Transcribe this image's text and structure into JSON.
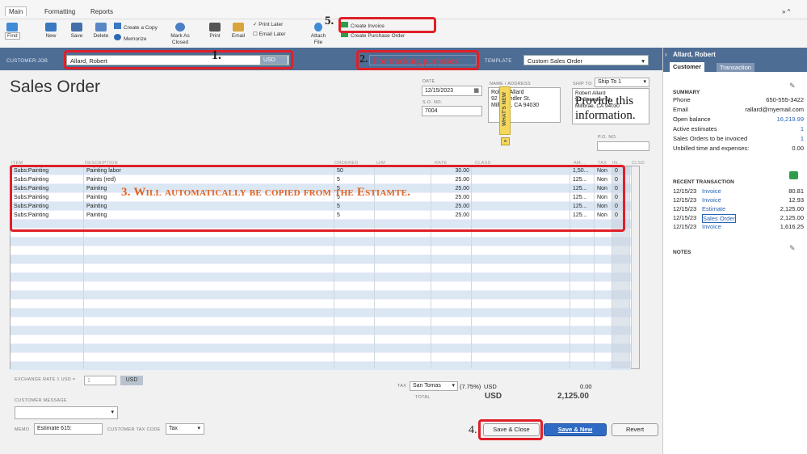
{
  "ribbon": {
    "tabs": [
      "Main",
      "Formatting",
      "Reports"
    ],
    "window_controls": "»  ^"
  },
  "toolbar": {
    "find": "Find",
    "new": "New",
    "save": "Save",
    "delete": "Delete",
    "create_copy": "Create a Copy",
    "memorize": "Memorize",
    "mark_closed": "Mark As Closed",
    "print": "Print",
    "email": "Email",
    "print_later": "Print Later",
    "email_later": "Email Later",
    "attach_file": "Attach File",
    "create_invoice": "Create Invoice",
    "create_po": "Create Purchase Order"
  },
  "customer_bar": {
    "label": "CUSTOMER:JOB",
    "customer": "Allard, Robert",
    "currency": "USD",
    "template_label": "TEMPLATE",
    "template": "Custom Sales Order",
    "class_value": "For tracking purposes"
  },
  "form": {
    "title": "Sales Order",
    "date_label": "DATE",
    "date": "12/15/2023",
    "so_label": "S.O. NO.",
    "so_no": "7004",
    "name_address_label": "NAME / ADDRESS",
    "name_address": [
      "Robert Allard",
      "92 Chandler St.",
      "Millbrae, CA 94030"
    ],
    "whats_new": "WHAT'S NEW",
    "ship_to_label": "SHIP TO",
    "ship_to": "Ship To 1",
    "ship_address": [
      "Robert Allard",
      "92 Chandler St.",
      "Millbrae, CA 94030"
    ],
    "po_label": "P.O. NO."
  },
  "grid": {
    "headers": [
      "ITEM",
      "DESCRIPTION",
      "ORDERED",
      "U/M",
      "RATE",
      "CLASS",
      "AM...",
      "TAX",
      "IN...",
      "CLSD"
    ],
    "rows": [
      {
        "item": "Subs:Painting",
        "desc": "Painting labor",
        "ordered": "50",
        "rate": "30.00",
        "amt": "1,50...",
        "tax": "Non",
        "inv": "0"
      },
      {
        "item": "Subs:Painting",
        "desc": "Paints (red)",
        "ordered": "5",
        "rate": "25.00",
        "amt": "125...",
        "tax": "Non",
        "inv": "0"
      },
      {
        "item": "Subs:Painting",
        "desc": "Painting",
        "ordered": "5",
        "rate": "25.00",
        "amt": "125...",
        "tax": "Non",
        "inv": "0"
      },
      {
        "item": "Subs:Painting",
        "desc": "Painting",
        "ordered": "5",
        "rate": "25.00",
        "amt": "125...",
        "tax": "Non",
        "inv": "0"
      },
      {
        "item": "Subs:Painting",
        "desc": "Painting",
        "ordered": "5",
        "rate": "25.00",
        "amt": "125...",
        "tax": "Non",
        "inv": "0"
      },
      {
        "item": "Subs:Painting",
        "desc": "Painting",
        "ordered": "5",
        "rate": "25.00",
        "amt": "125...",
        "tax": "Non",
        "inv": "0"
      }
    ]
  },
  "footer": {
    "exchange_label": "EXCHANGE RATE 1 USD =",
    "exchange_value": "1",
    "exchange_currency": "USD",
    "customer_message_label": "CUSTOMER MESSAGE",
    "memo_label": "MEMO",
    "memo": "Estimate 615:",
    "tax_code_label": "CUSTOMER TAX CODE",
    "tax_code": "Tax",
    "tax_label": "TAX",
    "tax_item": "San Tomas",
    "tax_rate": "(7.75%)",
    "tax_currency": "USD",
    "tax_amount": "0.00",
    "total_label": "TOTAL",
    "total_currency": "USD",
    "total": "2,125.00",
    "save_close": "Save & Close",
    "save_new": "Save & New",
    "revert": "Revert"
  },
  "annotations": {
    "a1": "1.",
    "a2": "2.",
    "a3": "3. Will automatically be copied from the Estiamte.",
    "a4": "4.",
    "a5": "5.",
    "provide": "Provide this information."
  },
  "panel": {
    "customer": "Allard, Robert",
    "tab_customer": "Customer",
    "tab_transaction": "Transaction",
    "summary": "SUMMARY",
    "summary_rows": [
      {
        "label": "Phone",
        "value": "650-555-3422"
      },
      {
        "label": "Email",
        "value": "rallard@myemail.com"
      },
      {
        "label": "Open balance",
        "value": "16,219.99"
      },
      {
        "label": "Active estimates",
        "value": "1"
      },
      {
        "label": "Sales Orders to be invoiced",
        "value": "1"
      },
      {
        "label": "Unbilled time and expenses:",
        "value": "0.00"
      }
    ],
    "recent": "RECENT TRANSACTION",
    "recent_rows": [
      {
        "date": "12/15/23",
        "type": "Invoice",
        "amount": "80.81"
      },
      {
        "date": "12/15/23",
        "type": "Invoice",
        "amount": "12.93"
      },
      {
        "date": "12/15/23",
        "type": "Estimate",
        "amount": "2,125.00"
      },
      {
        "date": "12/15/23",
        "type": "Sales Order",
        "amount": "2,125.00"
      },
      {
        "date": "12/15/23",
        "type": "Invoice",
        "amount": "1,616.25"
      }
    ],
    "notes": "NOTES"
  },
  "colors": {
    "bar": "#4d6d95",
    "annotation_red": "#e01f28",
    "link": "#2a62b5"
  }
}
